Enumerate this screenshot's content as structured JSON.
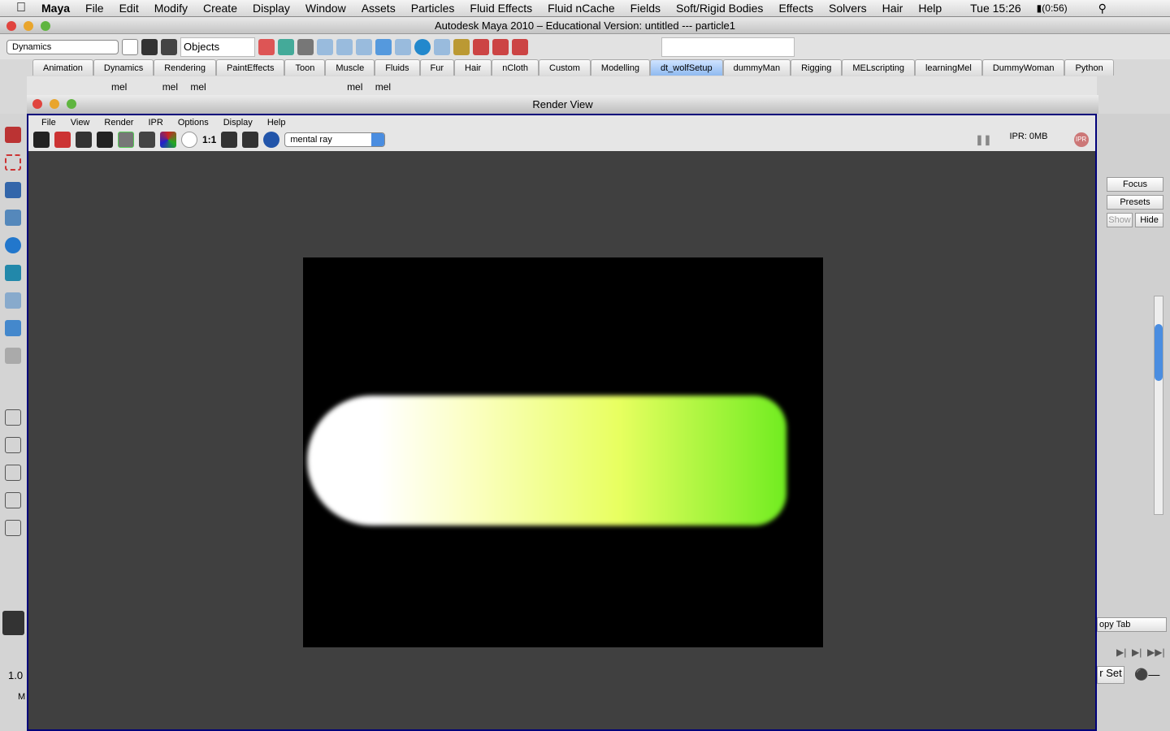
{
  "mac_menu": {
    "app": "Maya",
    "items": [
      "File",
      "Edit",
      "Modify",
      "Create",
      "Display",
      "Window",
      "Assets",
      "Particles",
      "Fluid Effects",
      "Fluid nCache",
      "Fields",
      "Soft/Rigid Bodies",
      "Effects",
      "Solvers",
      "Hair",
      "Help"
    ],
    "clock": "Tue 15:26",
    "battery": "(0:56)"
  },
  "window_title": "Autodesk Maya 2010 – Educational Version: untitled   ---   particle1",
  "toolbar": {
    "menu_set": "Dynamics",
    "selection_mode": "Objects"
  },
  "shelf_tabs": [
    "Animation",
    "Dynamics",
    "Rendering",
    "PaintEffects",
    "Toon",
    "Muscle",
    "Fluids",
    "Fur",
    "Hair",
    "nCloth",
    "Custom",
    "Modelling",
    "dt_wolfSetup",
    "dummyMan",
    "Rigging",
    "MELscripting",
    "learningMel",
    "DummyWoman",
    "Python"
  ],
  "active_shelf": "dt_wolfSetup",
  "shelf_labels": [
    "mel",
    "mel",
    "mel",
    "mel",
    "mel"
  ],
  "render_view": {
    "title": "Render View",
    "menu": [
      "File",
      "View",
      "Render",
      "IPR",
      "Options",
      "Display",
      "Help"
    ],
    "ratio_label": "1:1",
    "renderer": "mental ray",
    "ipr_memory": "IPR: 0MB",
    "ipr_badge": "IPR"
  },
  "right_panel": {
    "focus": "Focus",
    "presets": "Presets",
    "show": "Show",
    "hide": "Hide",
    "copy_tab": "opy Tab",
    "char_set": "r Set"
  },
  "left_panel": {
    "value": "1.0",
    "label": "M"
  }
}
